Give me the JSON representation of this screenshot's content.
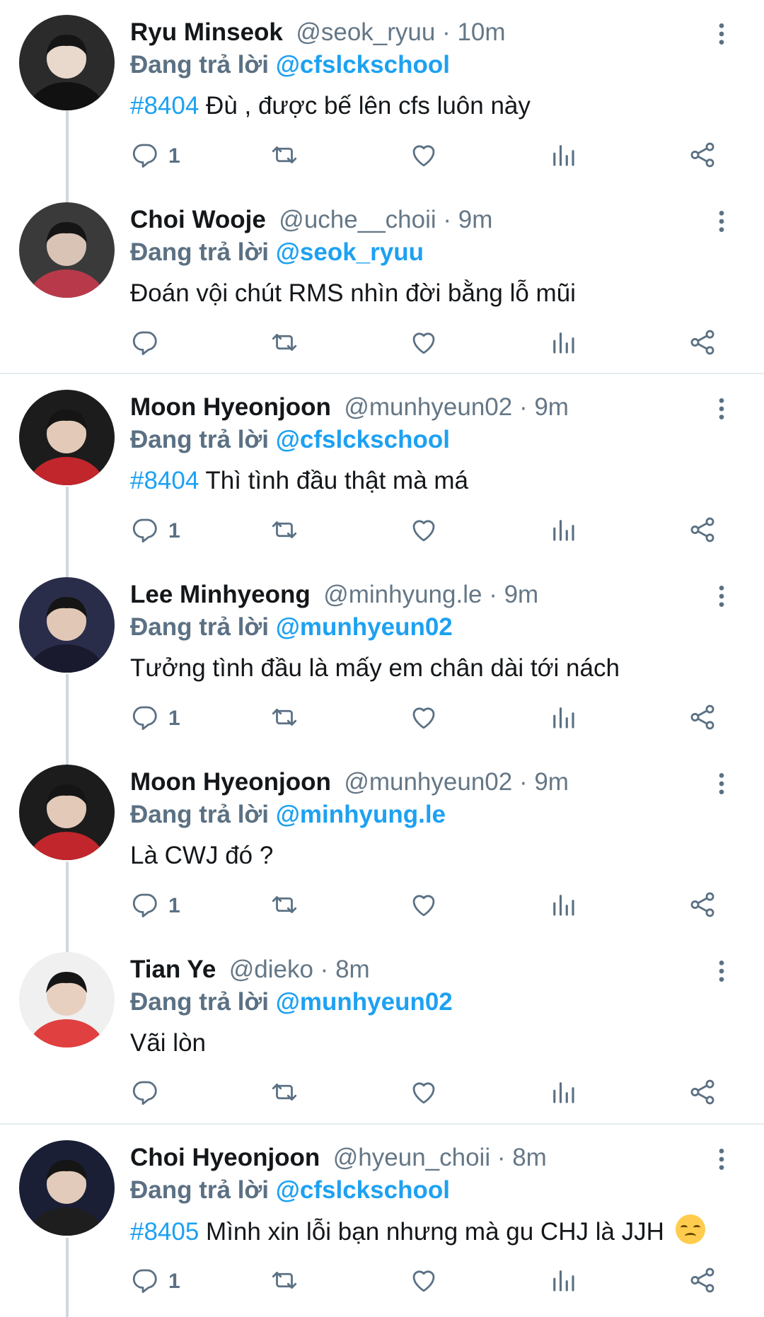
{
  "colors": {
    "accent": "#1da1f2",
    "text": "#14171a",
    "muted": "#657786",
    "divider": "#e6ecf0",
    "thread_line": "#cfd9de"
  },
  "reply_prefix": "Đang trả lời",
  "tweets": [
    {
      "name": "Ryu Minseok",
      "handle": "@seok_ryuu",
      "time": "10m",
      "reply_to": "@cfslckschool",
      "tag": "#8404",
      "text": " Đù , được bế lên cfs luôn này",
      "reply_count": "1",
      "avatar_icon": "avatar-photo"
    },
    {
      "name": "Choi Wooje",
      "handle": "@uche__choii",
      "time": "9m",
      "reply_to": "@seok_ryuu",
      "tag": "",
      "text": "Đoán vội chút RMS nhìn đời bằng lỗ mũi",
      "reply_count": "",
      "avatar_icon": "avatar-photo"
    },
    {
      "name": "Moon Hyeonjoon",
      "handle": "@munhyeun02",
      "time": "9m",
      "reply_to": "@cfslckschool",
      "tag": "#8404",
      "text": " Thì tình đầu thật mà má",
      "reply_count": "1",
      "avatar_icon": "avatar-photo"
    },
    {
      "name": "Lee Minhyeong",
      "handle": "@minhyung.le",
      "time": "9m",
      "reply_to": "@munhyeun02",
      "tag": "",
      "text": "Tưởng tình đầu là mấy em chân dài tới nách",
      "reply_count": "1",
      "avatar_icon": "avatar-photo"
    },
    {
      "name": "Moon Hyeonjoon",
      "handle": "@munhyeun02",
      "time": "9m",
      "reply_to": "@minhyung.le",
      "tag": "",
      "text": "Là CWJ đó ?",
      "reply_count": "1",
      "avatar_icon": "avatar-photo"
    },
    {
      "name": "Tian Ye",
      "handle": "@dieko",
      "time": "8m",
      "reply_to": "@munhyeun02",
      "tag": "",
      "text": "Vãi lòn",
      "reply_count": "",
      "avatar_icon": "avatar-photo"
    },
    {
      "name": "Choi Hyeonjoon",
      "handle": "@hyeun_choii",
      "time": "8m",
      "reply_to": "@cfslckschool",
      "tag": "#8405",
      "text": " Mình xin lỗi bạn nhưng mà gu CHJ là JJH",
      "reply_count": "1",
      "avatar_icon": "avatar-photo",
      "emoji": "disappointed-face-emoji"
    }
  ]
}
